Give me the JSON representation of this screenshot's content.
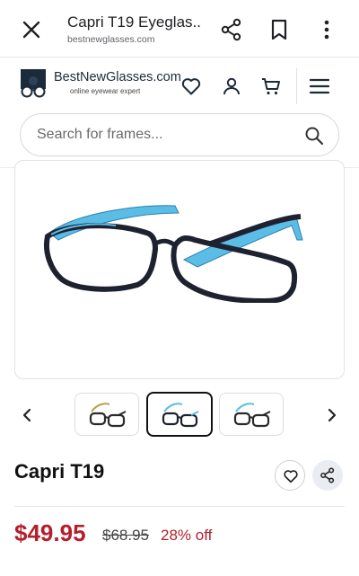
{
  "browser": {
    "title": "Capri T19 Eyeglas...",
    "url": "bestnewglasses.com",
    "icons": [
      "close-icon",
      "share-icon",
      "bookmark-icon",
      "more-vert-icon"
    ]
  },
  "site": {
    "brand": "BestNewGlasses.com",
    "tagline": "online eyewear expert",
    "icons": [
      "heart-icon",
      "user-icon",
      "cart-icon",
      "menu-icon"
    ]
  },
  "search": {
    "placeholder": "Search for frames...",
    "value": ""
  },
  "gallery": {
    "thumbnail_count": 3,
    "active_index": 1
  },
  "product": {
    "name": "Capri T19",
    "price": "$49.95",
    "original_price": "$68.95",
    "discount": "28% off"
  },
  "colors": {
    "price": "#b51f2c",
    "frame_front": "#1e2230",
    "temple_blue": "#5bbde6"
  }
}
